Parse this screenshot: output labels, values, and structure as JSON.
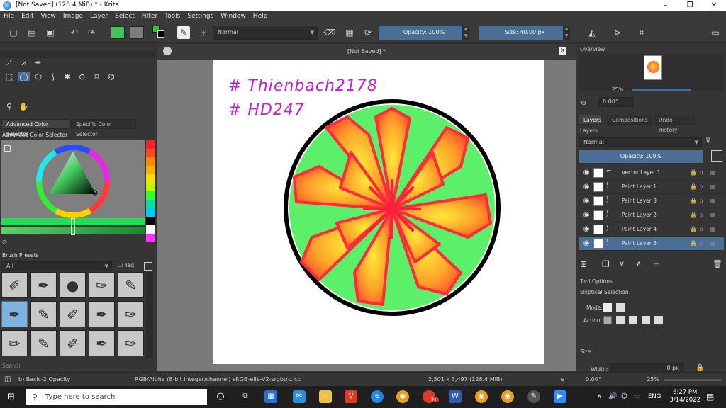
{
  "window": {
    "title": "[Not Saved]  (128.4 MiB)  * - Krita",
    "controls": [
      "–",
      "❐",
      "✕"
    ]
  },
  "menu": [
    "File",
    "Edit",
    "View",
    "Image",
    "Layer",
    "Select",
    "Filter",
    "Tools",
    "Settings",
    "Window",
    "Help"
  ],
  "toolbar": {
    "blend_mode": "Normal",
    "opacity_label": "Opacity: 100%",
    "size_label": "Size: 40.00 px",
    "fg_color": "#22cc22",
    "bg_color": "#7d7d7d"
  },
  "left_dock": {
    "color_tabs": [
      "Advanced Color Selector",
      "Specific Color Selector"
    ],
    "color_docker_title": "Advanced Color Selector",
    "brush_presets_title": "Brush Presets",
    "brush_filter": "All",
    "tag_label": "Tag",
    "search_placeholder": "Search"
  },
  "canvas": {
    "doc_title": "[Not Saved]  *",
    "text_line1": "# Thienbach2178",
    "text_line2": "# HD247"
  },
  "right_dock": {
    "overview_title": "Overview",
    "zoom": "25%",
    "rotation": "0.00°",
    "tabs": [
      "Layers",
      "Compositions",
      "Undo History"
    ],
    "layers_title": "Layers",
    "layer_blend": "Normal",
    "layer_opacity": "Opacity:  100%",
    "layers": [
      {
        "name": "Vector Layer 1",
        "type": "vector",
        "selected": false
      },
      {
        "name": "Paint Layer 1",
        "type": "paint",
        "selected": false
      },
      {
        "name": "Paint Layer 3",
        "type": "paint",
        "selected": false
      },
      {
        "name": "Paint Layer 2",
        "type": "paint",
        "selected": false
      },
      {
        "name": "Paint Layer 4",
        "type": "paint",
        "selected": false
      },
      {
        "name": "Paint Layer 5",
        "type": "paint",
        "selected": true
      }
    ],
    "tool_options_title": "Tool Options",
    "tool_name": "Elliptical Selection",
    "mode_label": "Mode:",
    "action_label": "Action:",
    "size_label": "Size",
    "width_label": "Width:",
    "width_value": "0 px"
  },
  "status": {
    "brush": "b) Basic-2 Opacity",
    "color_model": "RGB/Alpha (8-bit integer/channel)  sRGB-elle-V2-srgbtrc.icc",
    "dimensions": "2,501 x 3,497 (128.4 MiB)",
    "rotation": "0.00°",
    "zoom": "25%"
  },
  "taskbar": {
    "search_placeholder": "Type here to search",
    "time": "6:27 PM",
    "date": "3/14/2022",
    "lang": "ENG",
    "badge": "9+"
  }
}
